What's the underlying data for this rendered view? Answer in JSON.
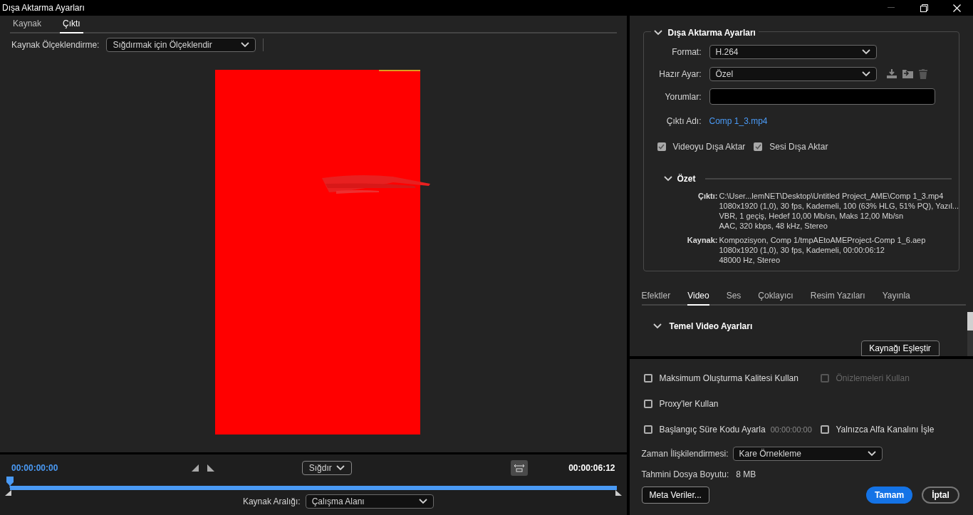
{
  "window": {
    "title": "Dışa Aktarma Ayarları"
  },
  "source_tabs": [
    {
      "label": "Kaynak",
      "selected": false
    },
    {
      "label": "Çıktı",
      "selected": true
    }
  ],
  "source_scaling": {
    "label": "Kaynak Ölçeklendirme:",
    "value": "Sığdırmak için Ölçeklendir"
  },
  "preview": {
    "kind": "picture"
  },
  "timeline": {
    "current_time": "00:00:00:00",
    "zoom": "Sığdır",
    "duration": "00:00:06:12",
    "level": 0
  },
  "source_range": {
    "label": "Kaynak Aralığı:",
    "value": "Çalışma Alanı"
  },
  "export_settings": {
    "title": "Dışa Aktarma Ayarları",
    "expanded": true,
    "format": {
      "label": "Format:",
      "value": "H.264"
    },
    "preset": {
      "label": "Hazır Ayar:",
      "value": "Özel"
    },
    "comments": {
      "label": "Yorumlar:"
    },
    "output_name": {
      "label": "Çıktı Adı:",
      "value": "Comp 1_3.mp4"
    },
    "checkboxes": [
      {
        "label": "Videoyu Dışa Aktar",
        "checked": true
      },
      {
        "label": "Sesi Dışa Aktar",
        "checked": true
      }
    ],
    "summary": {
      "title": "Özet",
      "expanded": true,
      "sections": [
        {
          "label": "Çıktı:",
          "lines": [
            "C:\\User...lemNET\\Desktop\\Untitled Project_AME\\Comp 1_3.mp4",
            "1080x1920 (1,0), 30 fps, Kademeli, 100 (63% HLG, 51% PQ), Yazıl...",
            "VBR, 1 geçiş, Hedef 10,00 Mb/sn, Maks 12,00 Mb/sn",
            "AAC, 320 kbps, 48 kHz, Stereo"
          ]
        },
        {
          "label": "Kaynak:",
          "lines": [
            "Kompozisyon, Comp 1/tmpAEtoAMEProject-Comp 1_6.aep",
            "1080x1920 (1,0), 30 fps, Kademeli, 00:00:06:12",
            "48000 Hz, Stereo"
          ]
        }
      ]
    }
  },
  "settings_tabs": [
    {
      "label": "Efektler",
      "selected": false
    },
    {
      "label": "Video",
      "selected": true
    },
    {
      "label": "Ses",
      "selected": false
    },
    {
      "label": "Çoklayıcı",
      "selected": false
    },
    {
      "label": "Resim Yazıları",
      "selected": false
    },
    {
      "label": "Yayınla",
      "selected": false
    }
  ],
  "video_section": {
    "title": "Temel Video Ayarları",
    "expanded": true,
    "button": "Kaynağı Eşleştir"
  },
  "option_rows": [
    [
      {
        "label": "Maksimum Oluşturma Kalitesi Kullan",
        "checked": false,
        "disabled": false
      },
      {
        "label": "Önizlemeleri Kullan",
        "checked": false,
        "disabled": true
      }
    ],
    [
      {
        "label": "Proxy'ler Kullan",
        "checked": false,
        "disabled": false
      }
    ],
    [
      {
        "label": "Başlangıç Süre Kodu Ayarla",
        "checked": false,
        "disabled": false,
        "timecode": "00:00:00:00"
      },
      {
        "label": "Yalnızca Alfa Kanalını İşle",
        "checked": false,
        "disabled": false
      }
    ]
  ],
  "time_interpolation": {
    "label": "Zaman İlişkilendirmesi:",
    "value": "Kare Örnekleme"
  },
  "file_size": {
    "label": "Tahmini Dosya Boyutu:",
    "value": "8 MB"
  },
  "buttons": [
    {
      "kind": "secondary",
      "label": "Meta Veriler..."
    },
    {
      "kind": "primary",
      "label": "Tamam"
    },
    {
      "kind": "cancel",
      "label": "İptal"
    }
  ]
}
